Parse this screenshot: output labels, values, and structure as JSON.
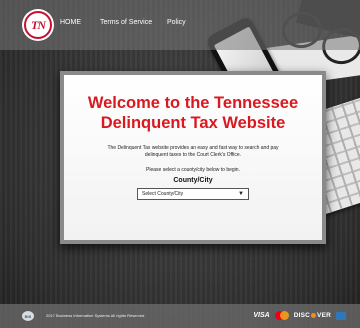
{
  "header": {
    "logo_text": "TN",
    "nav": [
      "HOME",
      "Terms of Service",
      "Policy"
    ]
  },
  "card": {
    "title_line1": "Welcome to the Tennessee",
    "title_line2": "Delinquent Tax Website",
    "description": "The Delinquent Tax website provides an easy and fast way to search and pay delinquent taxes to the Court Clerk's Office.",
    "prompt": "Please select a county/city below to begin.",
    "select_label": "County/City",
    "select_value": "Select County/City"
  },
  "footer": {
    "copyright": "2017 Business Information Systems All rights Reserved.",
    "visa": "VISA",
    "discover_left": "DISC",
    "discover_right": "VER"
  },
  "colors": {
    "title": "#d9181f",
    "accent": "#c8102e"
  },
  "icons": [
    "tn-logo-icon",
    "bis-logo-icon",
    "visa-icon",
    "mastercard-icon",
    "discover-icon",
    "amex-icon",
    "dropdown-arrow-icon"
  ]
}
